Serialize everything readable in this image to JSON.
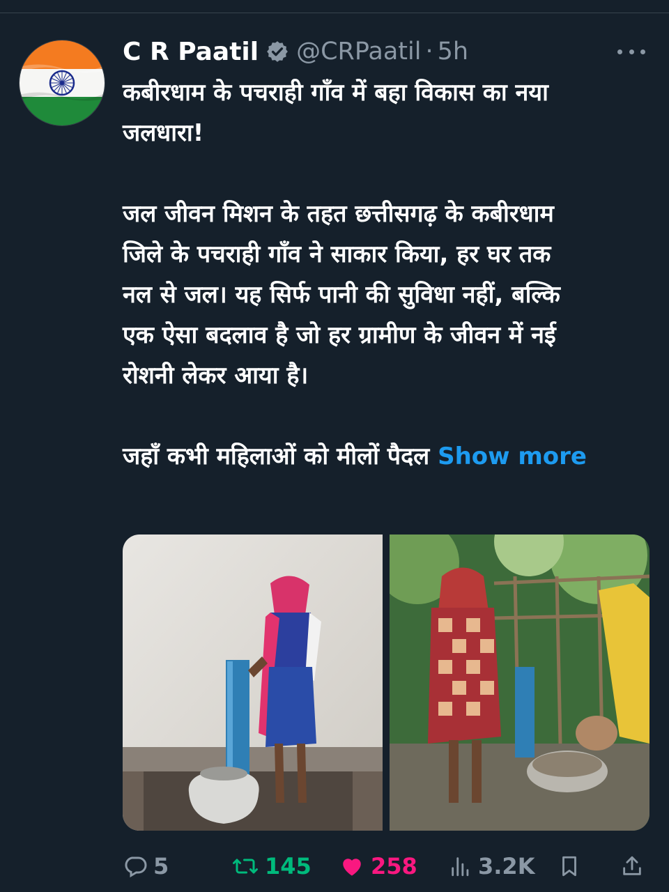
{
  "tweet": {
    "author": {
      "display_name": "C R Paatil",
      "handle": "@CRPaatil",
      "verified": true,
      "avatar": "indian-flag-avatar"
    },
    "separator": "·",
    "time": "5h",
    "text_lines": [
      "कबीरधाम के पचराही गाँव में बहा विकास का नया",
      "जलधारा!",
      "",
      "जल जीवन मिशन के तहत छत्तीसगढ़ के कबीरधाम",
      "जिले के पचराही गाँव ने साकार किया, हर घर तक",
      "नल से जल।  यह सिर्फ पानी की सुविधा नहीं, बल्कि",
      "एक ऐसा बदलाव है जो हर ग्रामीण के जीवन में नई",
      "रोशनी लेकर आया है।",
      "",
      "जहाँ कभी महिलाओं को मीलों पैदल"
    ],
    "show_more_label": "Show more",
    "media": [
      {
        "description_icon": "photo-woman-at-water-tap"
      },
      {
        "description_icon": "photo-woman-at-water-tap-outdoors"
      }
    ],
    "stats": {
      "replies": "5",
      "retweets": "145",
      "likes": "258",
      "views": "3.2K"
    }
  },
  "colors": {
    "background": "#15202b",
    "secondary_text": "#8b98a5",
    "link": "#1d9bf0",
    "retweet": "#00ba7c",
    "like": "#f91880"
  }
}
